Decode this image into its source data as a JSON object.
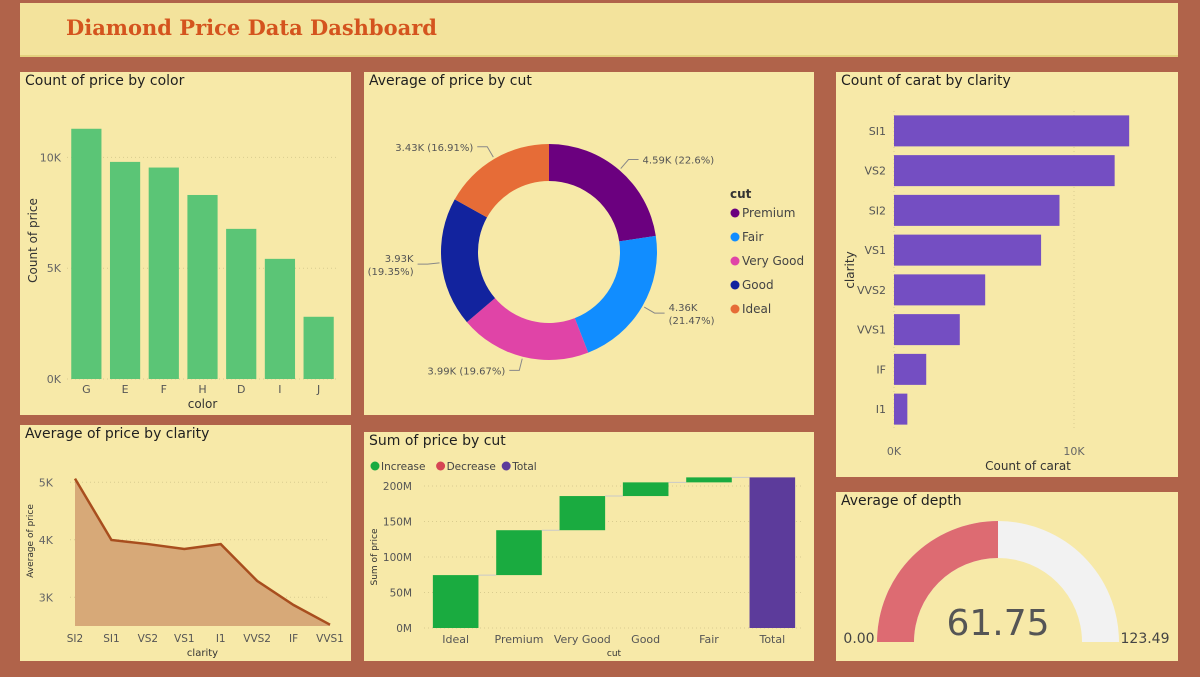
{
  "dashboard": {
    "title": "Diamond Price Data Dashboard"
  },
  "panels": {
    "color": {
      "title": "Count of price by color"
    },
    "cut_donut": {
      "title": "Average of price by cut"
    },
    "clarity_bar": {
      "title": "Count of carat by clarity"
    },
    "clarity_area": {
      "title": "Average of price by clarity"
    },
    "waterfall": {
      "title": "Sum of price by cut"
    },
    "depth": {
      "title": "Average of depth"
    }
  },
  "chart_data": [
    {
      "id": "color",
      "type": "bar",
      "title": "Count of price by color",
      "xlabel": "color",
      "ylabel": "Count of price",
      "categories": [
        "G",
        "E",
        "F",
        "H",
        "D",
        "I",
        "J"
      ],
      "values": [
        11292,
        9797,
        9542,
        8304,
        6775,
        5422,
        2808
      ],
      "ylim": [
        0,
        12500
      ],
      "yticks": [
        0,
        5000,
        10000
      ],
      "ytick_labels": [
        "0K",
        "5K",
        "10K"
      ],
      "color": "#5bc576"
    },
    {
      "id": "cut_donut",
      "type": "pie",
      "title": "Average of price by cut",
      "legend_title": "cut",
      "legend_position": "right",
      "categories": [
        "Premium",
        "Fair",
        "Very Good",
        "Good",
        "Ideal"
      ],
      "values": [
        4590,
        4360,
        3990,
        3930,
        3430
      ],
      "labels": [
        "4.59K (22.6%)",
        "4.36K (21.47%)",
        "3.99K (19.67%)",
        "3.93K (19.35%)",
        "3.43K (16.91%)"
      ],
      "colors": [
        "#6b007f",
        "#118dff",
        "#e044a7",
        "#12239e",
        "#e66c37"
      ]
    },
    {
      "id": "clarity_bar",
      "type": "bar",
      "orientation": "horizontal",
      "title": "Count of carat by clarity",
      "xlabel": "Count of carat",
      "ylabel": "clarity",
      "categories": [
        "SI1",
        "VS2",
        "SI2",
        "VS1",
        "VVS2",
        "VVS1",
        "IF",
        "I1"
      ],
      "values": [
        13065,
        12258,
        9194,
        8171,
        5066,
        3655,
        1790,
        741
      ],
      "xlim": [
        0,
        14000
      ],
      "xticks": [
        0,
        10000
      ],
      "xtick_labels": [
        "0K",
        "10K"
      ],
      "color": "#744ec2"
    },
    {
      "id": "clarity_area",
      "type": "area",
      "title": "Average of price by clarity",
      "xlabel": "clarity",
      "ylabel": "Average of price",
      "categories": [
        "SI2",
        "SI1",
        "VS2",
        "VS1",
        "I1",
        "VVS2",
        "IF",
        "VVS1"
      ],
      "values": [
        5063,
        3996,
        3925,
        3839,
        3924,
        3284,
        2865,
        2523
      ],
      "ylim": [
        2500,
        5300
      ],
      "yticks": [
        3000,
        4000,
        5000
      ],
      "ytick_labels": [
        "3K",
        "4K",
        "5K"
      ],
      "fill": "#d7a978",
      "line": "#a84e1e"
    },
    {
      "id": "waterfall",
      "type": "bar",
      "subtype": "waterfall",
      "title": "Sum of price by cut",
      "xlabel": "cut",
      "ylabel": "Sum of price",
      "categories": [
        "Ideal",
        "Premium",
        "Very Good",
        "Good",
        "Fair",
        "Total"
      ],
      "values": [
        74.51,
        63.22,
        48.11,
        19.28,
        7.02,
        212.14
      ],
      "legend": [
        "Increase",
        "Decrease",
        "Total"
      ],
      "legend_colors": [
        "#1aab40",
        "#d64554",
        "#5c3b9b"
      ],
      "legend_position": "top-left",
      "ylim": [
        0,
        200
      ],
      "yticks": [
        0,
        50,
        100,
        150,
        200
      ],
      "ytick_labels": [
        "0M",
        "50M",
        "100M",
        "150M",
        "200M"
      ]
    },
    {
      "id": "depth",
      "type": "gauge",
      "title": "Average of depth",
      "value": 61.75,
      "value_label": "61.75",
      "min": 0,
      "max": 123.49,
      "min_label": "0.00",
      "max_label": "123.49",
      "fill": "#dd6b72",
      "track": "#f2f2f2"
    }
  ]
}
